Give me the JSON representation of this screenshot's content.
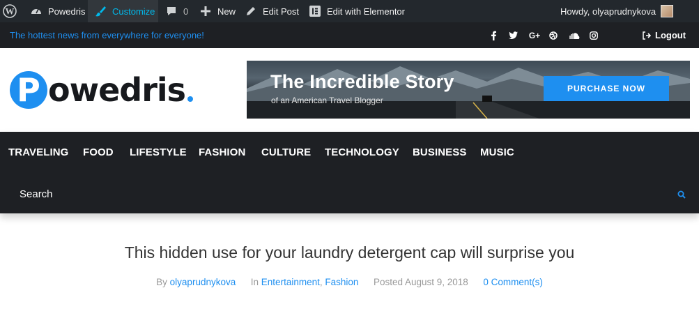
{
  "admin_bar": {
    "site_name": "Powedris",
    "customize": "Customize",
    "comments_count": "0",
    "new": "New",
    "edit_post": "Edit Post",
    "edit_elementor": "Edit with Elementor",
    "howdy": "Howdy, olyaprudnykova"
  },
  "topbar": {
    "tagline": "The hottest news from everywhere for everyone!",
    "social": [
      "facebook-icon",
      "twitter-icon",
      "google-plus-icon",
      "dribbble-icon",
      "soundcloud-icon",
      "instagram-icon"
    ],
    "logout": "Logout"
  },
  "header": {
    "logo_letter": "P",
    "logo_rest": "owedris",
    "banner": {
      "title": "The Incredible Story",
      "subtitle": "of an American Travel Blogger",
      "button": "PURCHASE NOW"
    }
  },
  "nav": {
    "items": [
      "TRAVELING",
      "FOOD",
      "LIFESTYLE",
      "FASHION",
      "CULTURE",
      "TECHNOLOGY",
      "BUSINESS",
      "MUSIC"
    ],
    "search_placeholder": "Search"
  },
  "article": {
    "title": "This hidden use for your laundry detergent cap will surprise you",
    "by": "By",
    "author": "olyaprudnykova",
    "in": "In",
    "category1": "Entertainment",
    "category2": "Fashion",
    "posted": "Posted August 9, 2018",
    "comments": "0 Comment(s)"
  },
  "colors": {
    "accent": "#1e8ff0",
    "admin_bar": "#23282d",
    "dark": "#1e2024"
  }
}
